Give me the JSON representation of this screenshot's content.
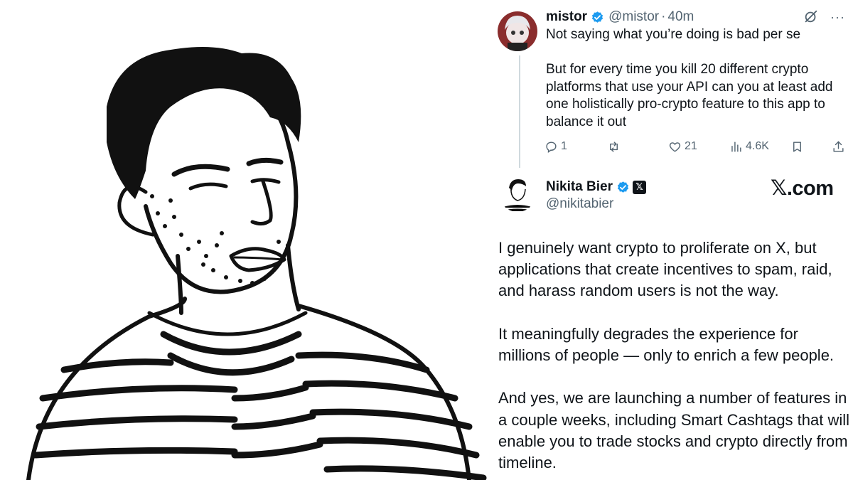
{
  "reply_tweet": {
    "display_name": "mistor",
    "handle": "@mistor",
    "separator": "·",
    "time": "40m",
    "text": "Not saying what you’re doing is bad per se\n\nBut for every time you kill 20 different crypto platforms that use your API can you at least add one holistically pro-crypto feature to this app to balance it out",
    "actions": {
      "replies": "1",
      "reposts": "",
      "likes": "21",
      "views": "4.6K"
    }
  },
  "main_tweet": {
    "display_name": "Nikita Bier",
    "handle": "@nikitabier",
    "affiliate_badge": "𝕏",
    "paragraphs": [
      "I genuinely want crypto to proliferate on X, but applications that create incentives to spam, raid, and harass random users is not the way.",
      "It meaningfully degrades the experience for millions of people — only to enrich a few people.",
      "And yes, we are launching a number of features in a couple weeks, including Smart Cashtags that will enable you to trade stocks and crypto directly from timeline."
    ]
  },
  "brand": "𝕏.com",
  "icons": {
    "verified": "verified-badge-icon",
    "grok": "grok-icon",
    "more": "more-icon",
    "reply": "reply-icon",
    "repost": "repost-icon",
    "like": "like-icon",
    "views": "views-icon",
    "bookmark": "bookmark-icon",
    "share": "share-icon"
  },
  "colors": {
    "verified_blue": "#1d9bf0",
    "text_primary": "#0f1419",
    "text_secondary": "#536471",
    "thread_line": "#cfd9de"
  }
}
